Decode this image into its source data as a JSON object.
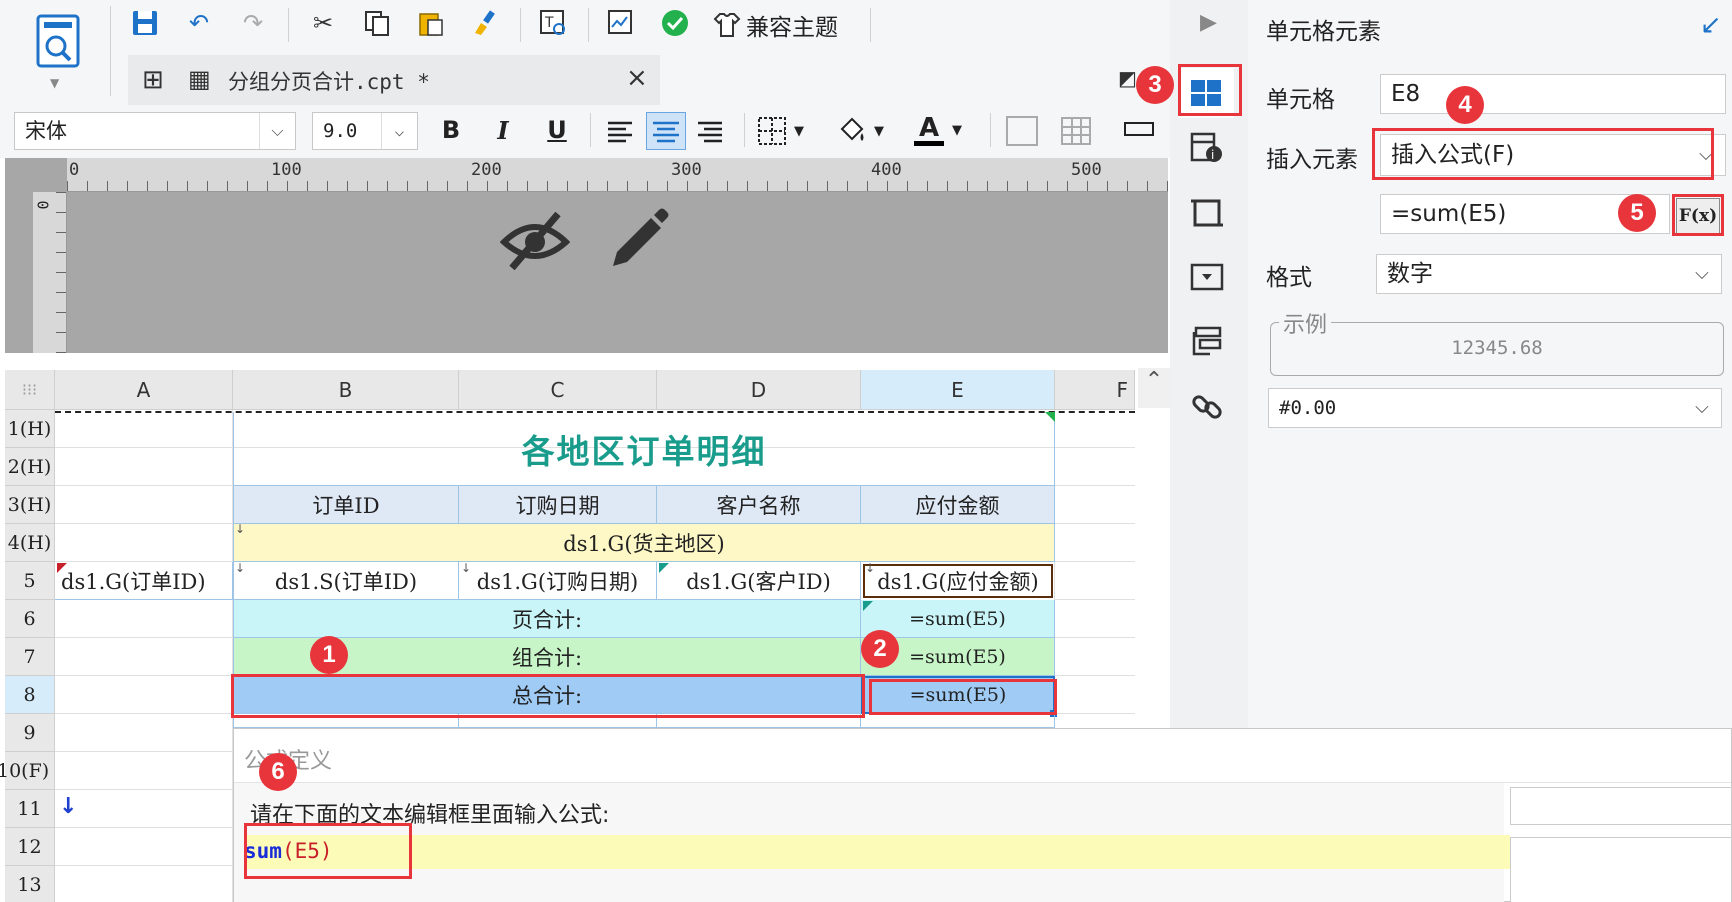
{
  "toolbar": {
    "compat_theme": "兼容主题",
    "tab_title": "分组分页合计.cpt *",
    "tab_close": "×",
    "font_name": "宋体",
    "font_size": "9.0",
    "bold": "B",
    "italic": "I",
    "underline": "U"
  },
  "ruler": {
    "ticks": [
      "0",
      "100",
      "200",
      "300",
      "400",
      "500"
    ],
    "v_zero": "0"
  },
  "columns": [
    "A",
    "B",
    "C",
    "D",
    "E",
    "F"
  ],
  "rows": [
    "1(H)",
    "2(H)",
    "3(H)",
    "4(H)",
    "5",
    "6",
    "7",
    "8",
    "9",
    "10(F)",
    "11",
    "12",
    "13"
  ],
  "report": {
    "title": "各地区订单明细",
    "headers": [
      "订单ID",
      "订购日期",
      "客户名称",
      "应付金额"
    ],
    "group_row": "ds1.G(货主地区)",
    "a5": "ds1.G(订单ID)",
    "b5": "ds1.S(订单ID)",
    "c5": "ds1.G(订购日期)",
    "d5": "ds1.G(客户ID)",
    "e5": "ds1.G(应付金额)",
    "page_total_label": "页合计:",
    "page_total_formula": "=sum(E5)",
    "group_total_label": "组合计:",
    "group_total_formula": "=sum(E5)",
    "grand_total_label": "总合计:",
    "grand_total_formula": "=sum(E5)",
    "row11_marker": "↓"
  },
  "panel": {
    "title": "单元格元素",
    "cell_label": "单元格",
    "cell_value": "E8",
    "insert_label": "插入元素",
    "insert_value": "插入公式(F)",
    "formula_value": "=sum(E5)",
    "fx_button": "F(x)",
    "format_label": "格式",
    "format_value": "数字",
    "example_legend": "示例",
    "example_value": "12345.68",
    "pattern_value": "#0.00"
  },
  "dialog": {
    "title": "公式定义",
    "prompt": "请在下面的文本编辑框里面输入公式:",
    "formula_fn": "sum",
    "formula_args": "(E5)"
  },
  "badges": [
    "1",
    "2",
    "3",
    "4",
    "5",
    "6"
  ],
  "colors": {
    "accent": "#1e73c8",
    "title_teal": "#1a9c8c",
    "header_blue": "#dfe8f5",
    "group_yellow": "#fdf8c6",
    "page_total_cyan": "#c9f5f8",
    "group_total_green": "#c8f5c8",
    "grand_total_blue": "#9fcbf5",
    "annotation_red": "#e8353b"
  }
}
